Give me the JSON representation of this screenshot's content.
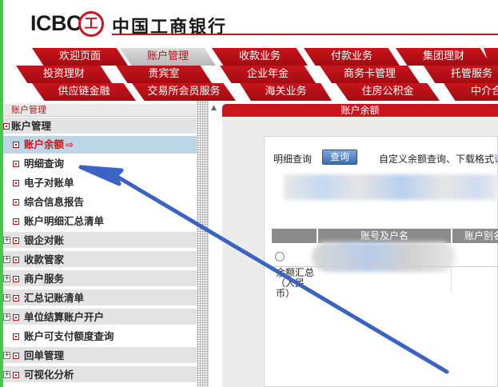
{
  "header": {
    "logo_text": "ICBC",
    "logo_mark": "工",
    "bank_name": "中国工商银行"
  },
  "nav": {
    "row1": [
      "欢迎页面",
      "账户管理",
      "收款业务",
      "付款业务",
      "集团理财",
      ""
    ],
    "row2": [
      "投资理财",
      "贵宾室",
      "企业年金",
      "商务卡管理",
      "托管服务"
    ],
    "row3": [
      "供应链金融",
      "交易所会员服务",
      "海关业务",
      "住房公积金",
      "中介合作"
    ],
    "active": "账户管理"
  },
  "left_panel": {
    "title": "账户管理",
    "tree": [
      {
        "label": "账户管理",
        "kind": "root"
      },
      {
        "label": "账户余额",
        "kind": "item",
        "selected": true
      },
      {
        "label": "明细查询",
        "kind": "item"
      },
      {
        "label": "电子对账单",
        "kind": "item"
      },
      {
        "label": "综合信息报告",
        "kind": "item"
      },
      {
        "label": "账户明细汇总清单",
        "kind": "item"
      },
      {
        "label": "银企对账",
        "kind": "group"
      },
      {
        "label": "收款管家",
        "kind": "group"
      },
      {
        "label": "商户服务",
        "kind": "group"
      },
      {
        "label": "汇总记账清单",
        "kind": "group"
      },
      {
        "label": "单位结算账户开户",
        "kind": "group"
      },
      {
        "label": "账户可支付额度查询",
        "kind": "item"
      },
      {
        "label": "回单管理",
        "kind": "group"
      },
      {
        "label": "可视化分析",
        "kind": "group"
      }
    ],
    "icons": {
      "item": "small-square-bullet-icon",
      "group": "plus-expander-icon",
      "selected_indicator": "right-arrow-icon"
    }
  },
  "right_panel": {
    "title": "账户余额",
    "detail_query_label": "明细查询",
    "query_button": "查询",
    "custom_text": "自定义余额查询、下载格式",
    "custom_link": "请",
    "table_headers": [
      "",
      "账号及户名",
      "账户别名"
    ],
    "summary_label": "余额汇总（人民币）"
  },
  "annotation": {
    "color": "#3b63c4"
  }
}
